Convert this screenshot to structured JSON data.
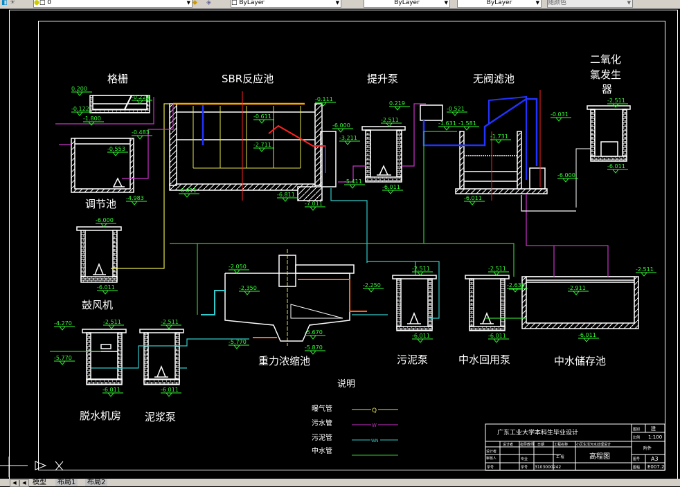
{
  "toolbar": {
    "layer_value": "0",
    "color_value": "ByLayer",
    "linetype_value": "ByLayer",
    "lineweight_value": "ByLayer",
    "plotstyle_value": "随颜色",
    "icons": [
      "layer-state-icon",
      "freeze-icon",
      "layer-color-icon",
      "make-current-icon",
      "layer-previous-icon"
    ]
  },
  "drawing": {
    "labels": {
      "screen": "格栅",
      "sbr": "SBR反应池",
      "lift_pump": "提升泵",
      "valveless_filter": "无阀滤池",
      "clo2_line1": "二氧化",
      "clo2_line2": "氯发生",
      "clo2_line3": "器",
      "equalization": "调节池",
      "blower": "鼓风机",
      "thickener": "重力浓缩池",
      "sludge_pump": "污泥泵",
      "reuse_pump": "中水回用泵",
      "reuse_tank": "中水储存池",
      "dewatering": "脱水机房",
      "slurry_pump": "泥浆泵"
    },
    "elevations": [
      "0.200",
      "-0.122",
      "-1.800",
      "-0.222",
      "-0.483",
      "-0.553",
      "-4.983",
      "-0.111",
      "-0.611",
      "-2.711",
      "-6.000",
      "-3.211",
      "-6.011",
      "-6.811",
      "-7.011",
      "-5.411",
      "0.219",
      "-2.511",
      "-6.011",
      "-0.521",
      "-1.631",
      "-1.581",
      "-1.731",
      "-0.031",
      "-6.000",
      "-6.011",
      "-2.511",
      "-6.011",
      "-6.000",
      "-6.011",
      "-2.050",
      "-2.350",
      "-2.250",
      "-5.670",
      "-5.870",
      "-5.770",
      "-2.511",
      "-6.011",
      "-2.511",
      "-6.011",
      "-2.636",
      "-2.511",
      "-2.911",
      "-6.011",
      "-4.270",
      "-5.770",
      "-2.511",
      "-6.011",
      "-2.511",
      "-6.011"
    ],
    "pipe_marks": {
      "air": "Q",
      "sewage": "W",
      "sludge": "WN"
    }
  },
  "legend": {
    "title": "说明",
    "items": [
      {
        "label": "曝气管",
        "mark": "Q",
        "color": "#e6e64d"
      },
      {
        "label": "污水管",
        "mark": "W",
        "color": "#cc33cc"
      },
      {
        "label": "污泥管",
        "mark": "WN",
        "color": "#33cccc"
      },
      {
        "label": "中水管",
        "mark": "",
        "color": "#33cc33"
      }
    ]
  },
  "title_block": {
    "school": "广东工业大学本科生毕业设计",
    "header_cells": [
      "班级",
      "设计者",
      "指导教师",
      "日期",
      "工程名称",
      "小区生活污水处理设计"
    ],
    "row_labels": [
      "设计者",
      "审核人",
      "学号"
    ],
    "cells": [
      "专业",
      "学号"
    ],
    "student_id": "3103000242",
    "drawing_title": "高程图",
    "project_short": "工 程",
    "right_labels": [
      "图别",
      "比例",
      "附件",
      "图号",
      "图幅"
    ],
    "right_values": [
      "建",
      "1:100",
      "A3",
      "E007.2"
    ]
  },
  "tabs": {
    "items": [
      "模型",
      "布局1",
      "布局2"
    ],
    "active": "模型"
  },
  "colors": {
    "background": "#000000",
    "structure": "#ffffff",
    "elevation": "#33ff33",
    "air_pipe": "#e6e64d",
    "sewage_pipe": "#cc33cc",
    "sludge_pipe": "#33cccc",
    "reuse_pipe": "#33cc33",
    "process_pipe": "#2233ff",
    "center_line": "#ff2222"
  }
}
